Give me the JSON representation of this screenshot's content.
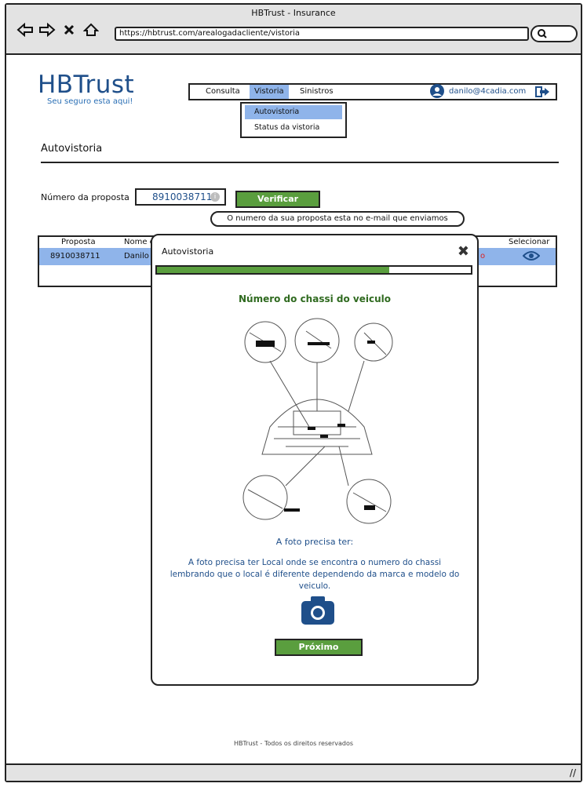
{
  "browser": {
    "window_title": "HBTrust - Insurance",
    "url": "https://hbtrust.com/arealogadacliente/vistoria"
  },
  "logo": {
    "title": "HBTrust",
    "subtitle": "Seu seguro esta aqui!"
  },
  "nav": {
    "items": [
      {
        "label": "Consulta"
      },
      {
        "label": "Vistoria"
      },
      {
        "label": "Sinistros"
      }
    ],
    "user_email": "danilo@4cadia.com"
  },
  "dropdown": {
    "items": [
      {
        "label": "Autovistoria"
      },
      {
        "label": "Status da vistoria"
      }
    ]
  },
  "page": {
    "title": "Autovistoria",
    "proposal_label": "Número da proposta",
    "proposal_value": "8910038711",
    "verify_button": "Verificar",
    "tooltip": "O numero da sua proposta esta no e-mail que enviamos"
  },
  "table": {
    "headers": {
      "proposta": "Proposta",
      "nome": "Nome c",
      "selecionar": "Selecionar"
    },
    "row": {
      "proposta": "8910038711",
      "nome": "Danilo",
      "flag": "o"
    }
  },
  "modal": {
    "title": "Autovistoria",
    "progress": 0.74,
    "section_title": "Número do chassi do veiculo",
    "photo_label": "A foto precisa ter:",
    "description": "A foto precisa ter Local onde se encontra o numero do chassi lembrando que o local é diferente dependendo da marca e modelo do veiculo.",
    "next_button": "Próximo"
  },
  "footer": {
    "text": "HBTrust - Todos os direitos reservados"
  },
  "colors": {
    "brand": "#1f4f8a",
    "accent_green": "#5a9e3e",
    "highlight": "#8fb4ea"
  }
}
